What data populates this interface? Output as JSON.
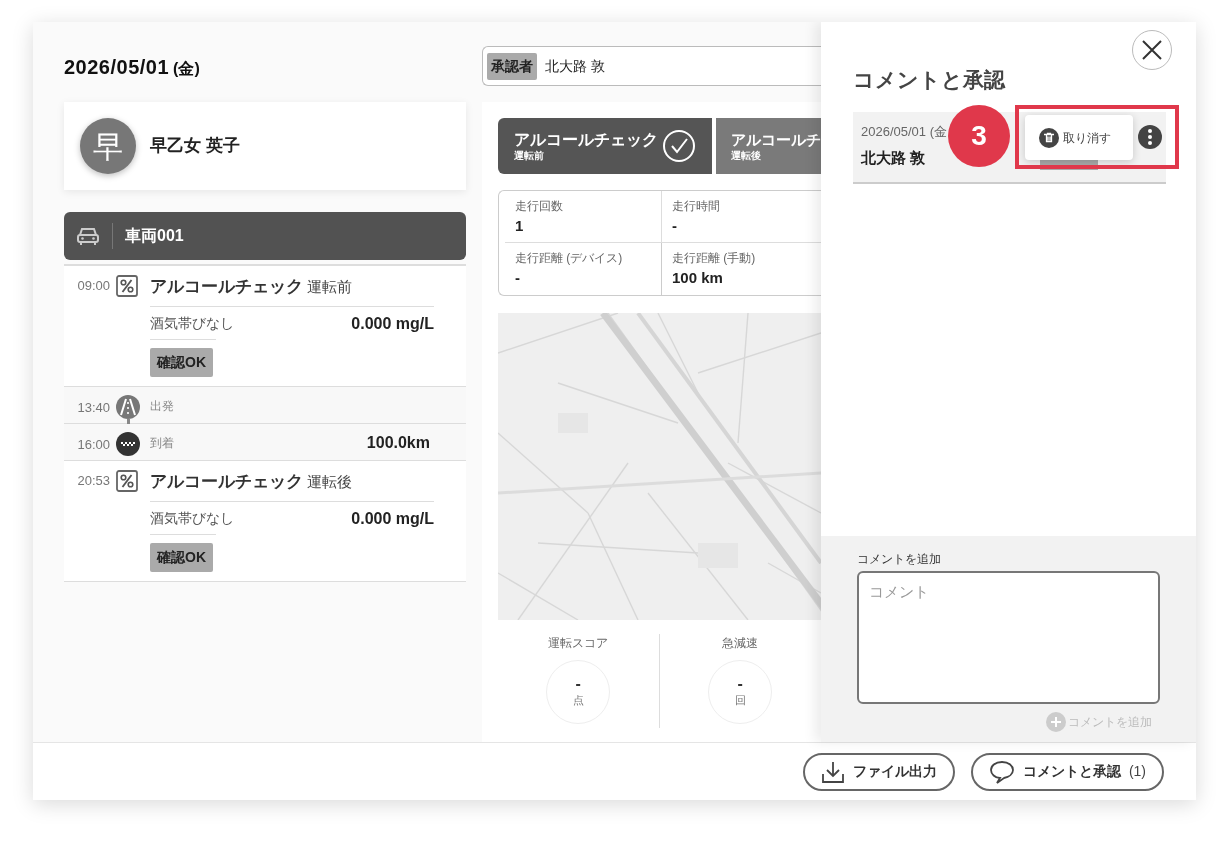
{
  "date": {
    "text": "2026/05/01",
    "weekday": "(金)"
  },
  "driver": {
    "avatar": "早",
    "name": "早乙女 英子"
  },
  "vehicle": {
    "name": "車両001"
  },
  "timeline": [
    {
      "kind": "alcohol",
      "time": "09:00",
      "title": "アルコールチェック",
      "subtitle": "運転前",
      "result": "酒気帯びなし",
      "reading": "0.000 mg/L",
      "badge": "確認OK"
    },
    {
      "kind": "depart",
      "time": "13:40",
      "label": "出発"
    },
    {
      "kind": "arrive",
      "time": "16:00",
      "label": "到着",
      "distance": "100.0km"
    },
    {
      "kind": "alcohol",
      "time": "20:53",
      "title": "アルコールチェック",
      "subtitle": "運転後",
      "result": "酒気帯びなし",
      "reading": "0.000 mg/L",
      "badge": "確認OK"
    }
  ],
  "approver": {
    "label": "承認者",
    "name": "北大路 敦"
  },
  "tabs": [
    {
      "title": "アルコールチェック",
      "subtitle": "運転前",
      "selected": true,
      "checked": true
    },
    {
      "title": "アルコールチ",
      "subtitle": "運転後",
      "selected": false
    }
  ],
  "stats": [
    {
      "label": "走行回数",
      "value": "1"
    },
    {
      "label": "走行時間",
      "value": "-"
    },
    {
      "label": "走行距離 (デバイス)",
      "value": "-"
    },
    {
      "label": "走行距離 (手動)",
      "value": "100 km"
    }
  ],
  "scores": [
    {
      "label": "運転スコア",
      "value": "-",
      "unit": "点"
    },
    {
      "label": "急減速",
      "value": "-",
      "unit": "回"
    }
  ],
  "drawer": {
    "title": "コメントと承認",
    "comments": [
      {
        "date": "2026/05/01 (金",
        "author": "北大路 敦"
      }
    ],
    "menu": [
      {
        "label": "取り消す"
      }
    ],
    "add_label": "コメントを追加",
    "placeholder": "コメント",
    "add_button": "コメントを追加"
  },
  "annotation": {
    "number": "3"
  },
  "footer": {
    "buttons": [
      {
        "kind": "export",
        "label": "ファイル出力"
      },
      {
        "kind": "comments",
        "label": "コメントと承認",
        "count": "(1)"
      }
    ]
  }
}
